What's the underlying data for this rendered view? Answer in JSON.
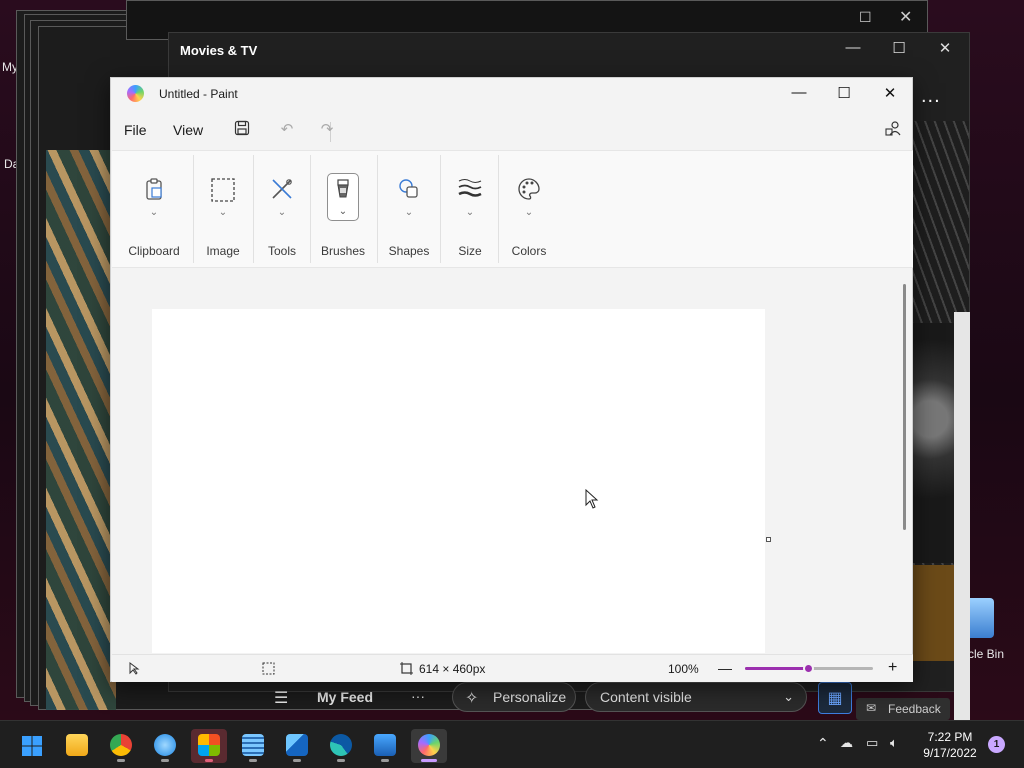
{
  "desktop": {
    "left_label_1": "My",
    "left_label_2": "Da",
    "recycle_bin_label": "cle Bin"
  },
  "movies_window": {
    "title": "Movies & TV",
    "more_glyph": "...",
    "feed": {
      "menu_glyph": "☰",
      "my_feed": "My Feed",
      "more_glyph": "···",
      "personalize": "Personalize",
      "content_visible": "Content visible",
      "feedback": "Feedback"
    }
  },
  "paint": {
    "title": "Untitled - Paint",
    "menus": {
      "file": "File",
      "view": "View"
    },
    "ribbon": {
      "groups": [
        {
          "label": "Clipboard",
          "icon": "clipboard-icon"
        },
        {
          "label": "Image",
          "icon": "selection-icon"
        },
        {
          "label": "Tools",
          "icon": "tools-icon"
        },
        {
          "label": "Brushes",
          "icon": "brush-icon"
        },
        {
          "label": "Shapes",
          "icon": "shapes-icon"
        },
        {
          "label": "Size",
          "icon": "size-icon"
        },
        {
          "label": "Colors",
          "icon": "palette-icon"
        }
      ]
    },
    "status": {
      "canvas_size": "614 × 460px",
      "zoom": "100%",
      "zoom_level": 0.5
    },
    "accent_color": "#9b2fae"
  },
  "taskbar": {
    "time": "7:22 PM",
    "date": "9/17/2022",
    "notification_count": "1"
  }
}
